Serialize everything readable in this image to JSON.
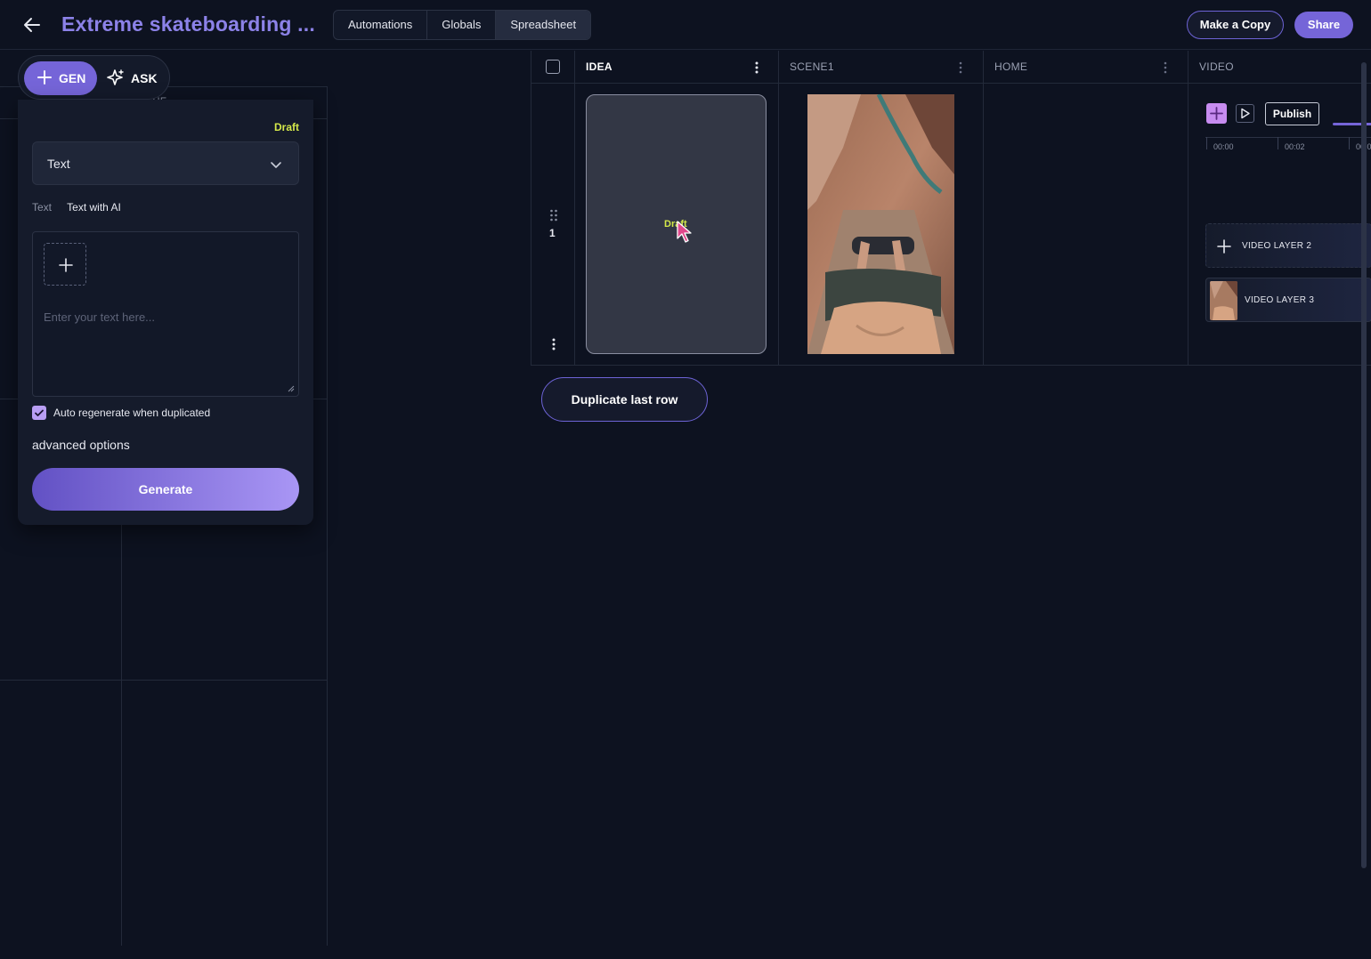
{
  "header": {
    "title": "Extreme skateboarding ...",
    "tabs": [
      {
        "label": "Automations",
        "active": false
      },
      {
        "label": "Globals",
        "active": false
      },
      {
        "label": "Spreadsheet",
        "active": true
      }
    ],
    "make_copy_label": "Make a Copy",
    "share_label": "Share"
  },
  "mode_toggle": {
    "gen_label": "GEN",
    "ask_label": "ASK"
  },
  "left_table": {
    "value_header": "VALUE"
  },
  "gen_panel": {
    "status": "Draft",
    "type_selected": "Text",
    "sub_tabs": [
      "Text",
      "Text with AI"
    ],
    "prompt_placeholder": "Enter your text here...",
    "auto_regenerate_label": "Auto regenerate when duplicated",
    "auto_regenerate_checked": true,
    "advanced_label": "advanced options",
    "generate_label": "Generate"
  },
  "sheet": {
    "columns": [
      "IDEA",
      "SCENE1",
      "HOME",
      "VIDEO"
    ],
    "rows": [
      {
        "number": "1",
        "idea_status": "Draft"
      }
    ],
    "video": {
      "publish_label": "Publish",
      "timeline_ticks": [
        "00:00",
        "00:02",
        "00:0"
      ],
      "layers": [
        "VIDEO LAYER 2",
        "VIDEO LAYER 3"
      ]
    },
    "duplicate_label": "Duplicate last row"
  },
  "colors": {
    "accent": "#7565d8",
    "draft": "#d4e84a",
    "background": "#0d1220"
  }
}
